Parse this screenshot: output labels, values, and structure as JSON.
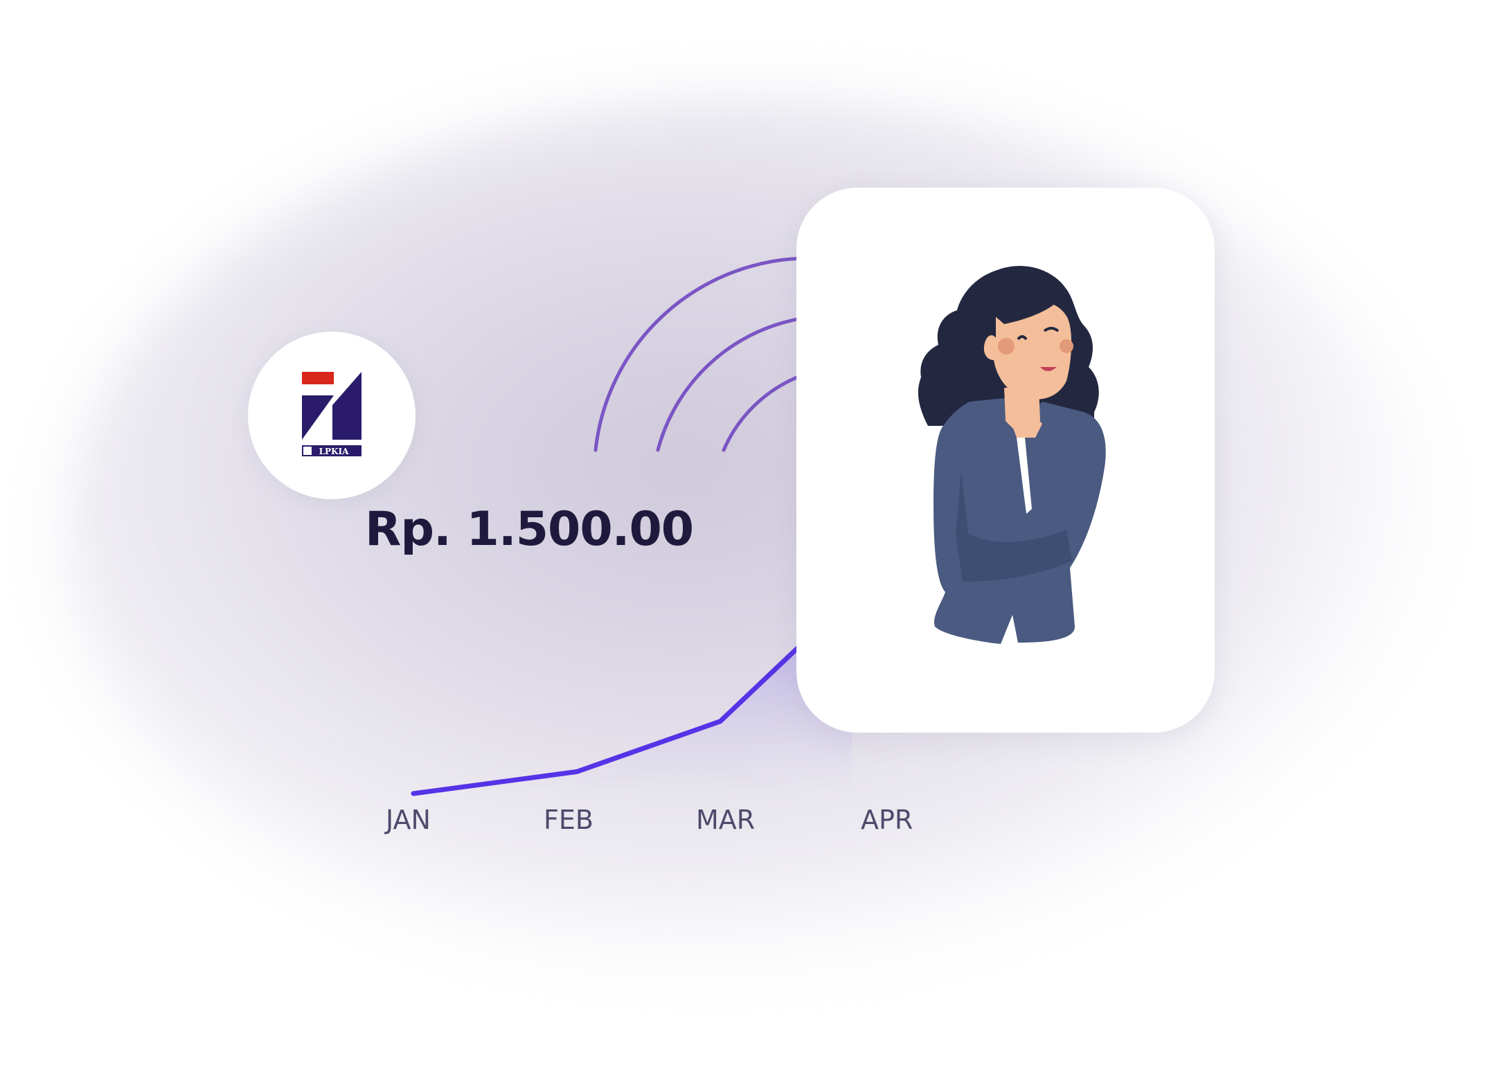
{
  "logo": {
    "text": "LPKIA",
    "colors": {
      "navy": "#2b1c6b",
      "red": "#d9261c"
    }
  },
  "amount": "Rp. 1.500.00",
  "chart_data": {
    "type": "line",
    "categories": [
      "JAN",
      "FEB",
      "MAR",
      "APR"
    ],
    "values": [
      0,
      0.1,
      0.33,
      0.9
    ],
    "line_color": "#5533e6"
  },
  "illustration": {
    "icon": "thinking-woman-illustration",
    "colors": {
      "hair": "#232840",
      "jacket": "#4a5a80",
      "skin": "#f4be9a"
    }
  },
  "signal": {
    "icon": "signal-arcs",
    "color": "#7a55c4"
  }
}
